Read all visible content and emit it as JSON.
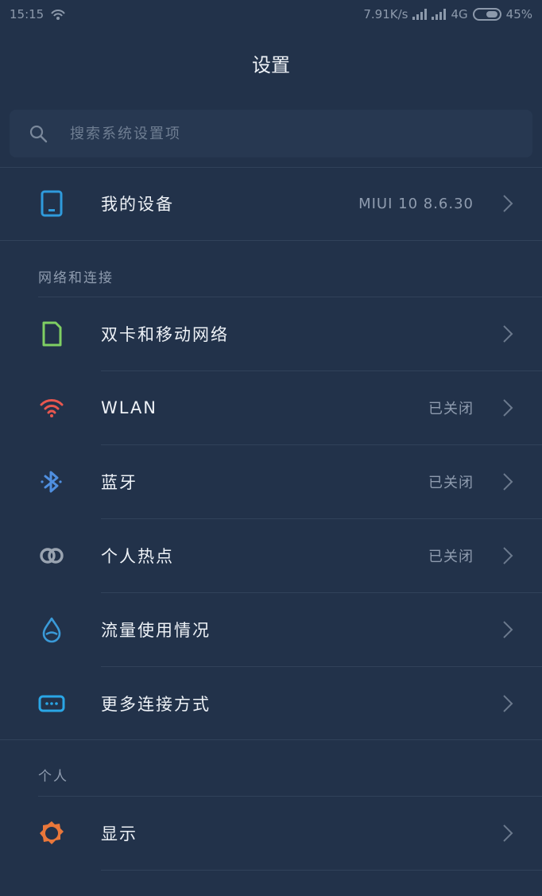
{
  "status_bar": {
    "time": "15:15",
    "speed": "7.91K/s",
    "network": "4G",
    "battery": "45%"
  },
  "header": {
    "title": "设置"
  },
  "search": {
    "placeholder": "搜索系统设置项"
  },
  "my_device": {
    "label": "我的设备",
    "value": "MIUI 10 8.6.30"
  },
  "sections": {
    "network": "网络和连接",
    "personal": "个人"
  },
  "items": [
    {
      "label": "双卡和移动网络",
      "value": ""
    },
    {
      "label": "WLAN",
      "value": "已关闭"
    },
    {
      "label": "蓝牙",
      "value": "已关闭"
    },
    {
      "label": "个人热点",
      "value": "已关闭"
    },
    {
      "label": "流量使用情况",
      "value": ""
    },
    {
      "label": "更多连接方式",
      "value": ""
    }
  ],
  "display": {
    "label": "显示"
  },
  "colors": {
    "background": "#22324a",
    "device_icon": "#2f9bdc",
    "sim_icon": "#7fcf63",
    "wlan_icon": "#e8574f",
    "bluetooth_icon": "#4f8fe0",
    "hotspot_icon": "#9aa4b1",
    "data_icon": "#3a9ad8",
    "more_icon": "#2aa6e6",
    "display_icon": "#e9773a"
  }
}
